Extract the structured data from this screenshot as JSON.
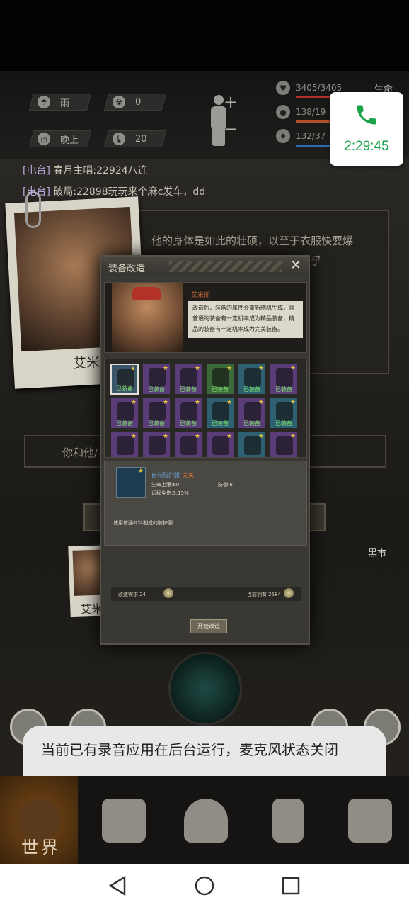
{
  "stats": {
    "weather": "雨",
    "radiation": "0",
    "time_of_day": "晚上",
    "temperature": "20"
  },
  "vitals": [
    {
      "value": "3405/3405",
      "label": "生命",
      "color": "#b03030"
    },
    {
      "value": "138/19",
      "label": "",
      "color": "#b0502a"
    },
    {
      "value": "132/37",
      "label": "",
      "color": "#2a6fb0"
    }
  ],
  "call": {
    "time": "2:29:45"
  },
  "chat": [
    {
      "channel": "[电台]",
      "text": " 春月主唱:22924八连"
    },
    {
      "channel": "[电台]",
      "text": " 破局:22898玩玩来个麻c发车，dd"
    }
  ],
  "scene": {
    "description": "他的身体是如此的壮硕，以至于衣服快要爆",
    "description_2": "……似乎",
    "bar_text": "你和他/",
    "polaroid_name": "艾米丽",
    "polaroid2_name": "艾米",
    "black_market": "黑市"
  },
  "modal": {
    "title": "装备改造",
    "character_name": "艾米丽",
    "description": "改造后，装备的属性会重新随机生成，且普通的装备有一定机率成为精品装备，精品的装备有一定机率成为完美装备。",
    "equipped_tag": "已装备",
    "slots": [
      {
        "color": "#3c556a",
        "equipped": true,
        "selected": true
      },
      {
        "color": "#5a3c78",
        "equipped": true
      },
      {
        "color": "#5a3c78",
        "equipped": true
      },
      {
        "color": "#3b6a3a",
        "equipped": true
      },
      {
        "color": "#2d6070",
        "equipped": true
      },
      {
        "color": "#5a3c78",
        "equipped": true
      },
      {
        "color": "#5a3c78",
        "equipped": true
      },
      {
        "color": "#5a3c78",
        "equipped": true
      },
      {
        "color": "#5a3c78",
        "equipped": true
      },
      {
        "color": "#2d6070",
        "equipped": true
      },
      {
        "color": "#5a3c78",
        "equipped": true
      },
      {
        "color": "#2d6070",
        "equipped": true
      },
      {
        "color": "#5a3c78",
        "equipped": false
      },
      {
        "color": "#5a3c78",
        "equipped": false
      },
      {
        "color": "#5a3c78",
        "equipped": false
      },
      {
        "color": "#5a3c78",
        "equipped": false
      },
      {
        "color": "#2d6070",
        "equipped": false
      },
      {
        "color": "#5a3c78",
        "equipped": false
      }
    ],
    "item": {
      "name": "自制防护服",
      "quality": "完美",
      "hp_label": "生命上限:60",
      "def_label": "防御:6",
      "ranged_label": "远程免伤:3.15%",
      "desc": "使用普通材料制成的防护服"
    },
    "requirement_label": "改造需求 24",
    "owned_label": "当前拥有 2584",
    "start_button": "开始改造"
  },
  "nav": {
    "world_label": "世界"
  },
  "toast": "当前已有录音应用在后台运行，麦克风状态关闭"
}
